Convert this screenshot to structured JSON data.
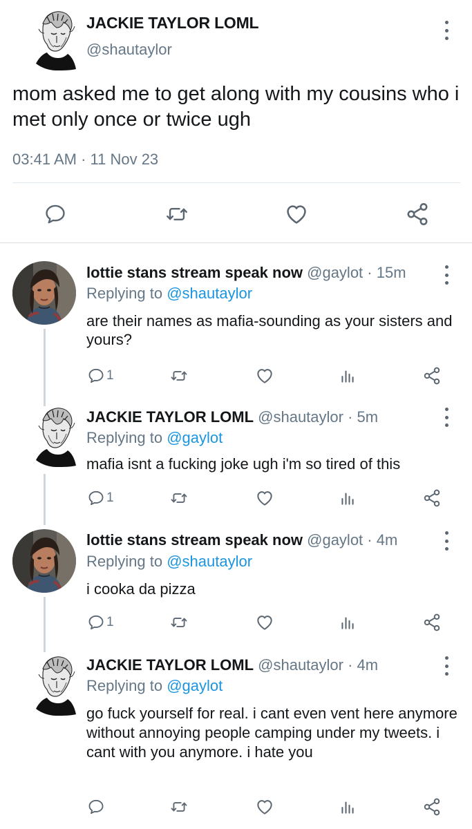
{
  "main_tweet": {
    "name": "JACKIE TAYLOR LOML",
    "handle": "@shautaylor",
    "text": "mom asked me to get along with my cousins who i met only once or twice ugh",
    "timestamp": "03:41 AM · 11 Nov 23",
    "icons": [
      "reply-icon",
      "retweet-icon",
      "like-icon",
      "share-icon"
    ]
  },
  "replies": [
    {
      "name": "lottie stans stream speak now",
      "handle": "@gaylot",
      "time": " · 15m",
      "replying_prefix": "Replying to ",
      "replying_to": "@shautaylor",
      "text": "are their names as mafia-sounding as your sisters and yours?",
      "reply_count": "1"
    },
    {
      "name": "JACKIE TAYLOR LOML",
      "handle": "@shautaylor",
      "time": " · 5m",
      "replying_prefix": "Replying to ",
      "replying_to": "@gaylot",
      "text": "mafia isnt a fucking joke ugh i'm so tired of this",
      "reply_count": "1"
    },
    {
      "name": "lottie stans stream speak now",
      "handle": "@gaylot",
      "time": " · 4m",
      "replying_prefix": "Replying to ",
      "replying_to": "@shautaylor",
      "text": "i cooka da pizza",
      "reply_count": "1"
    },
    {
      "name": "JACKIE TAYLOR LOML",
      "handle": "@shautaylor",
      "time": " · 4m",
      "replying_prefix": "Replying to ",
      "replying_to": "@gaylot",
      "text": "go fuck yourself for real. i cant even vent here anymore without annoying people camping under my tweets. i cant with you anymore. i hate you",
      "reply_count": ""
    }
  ],
  "colors": {
    "text": "#14171a",
    "secondary": "#657786",
    "link": "#1b95e0",
    "icon": "#5b6670",
    "divider": "#e1e8ed"
  }
}
